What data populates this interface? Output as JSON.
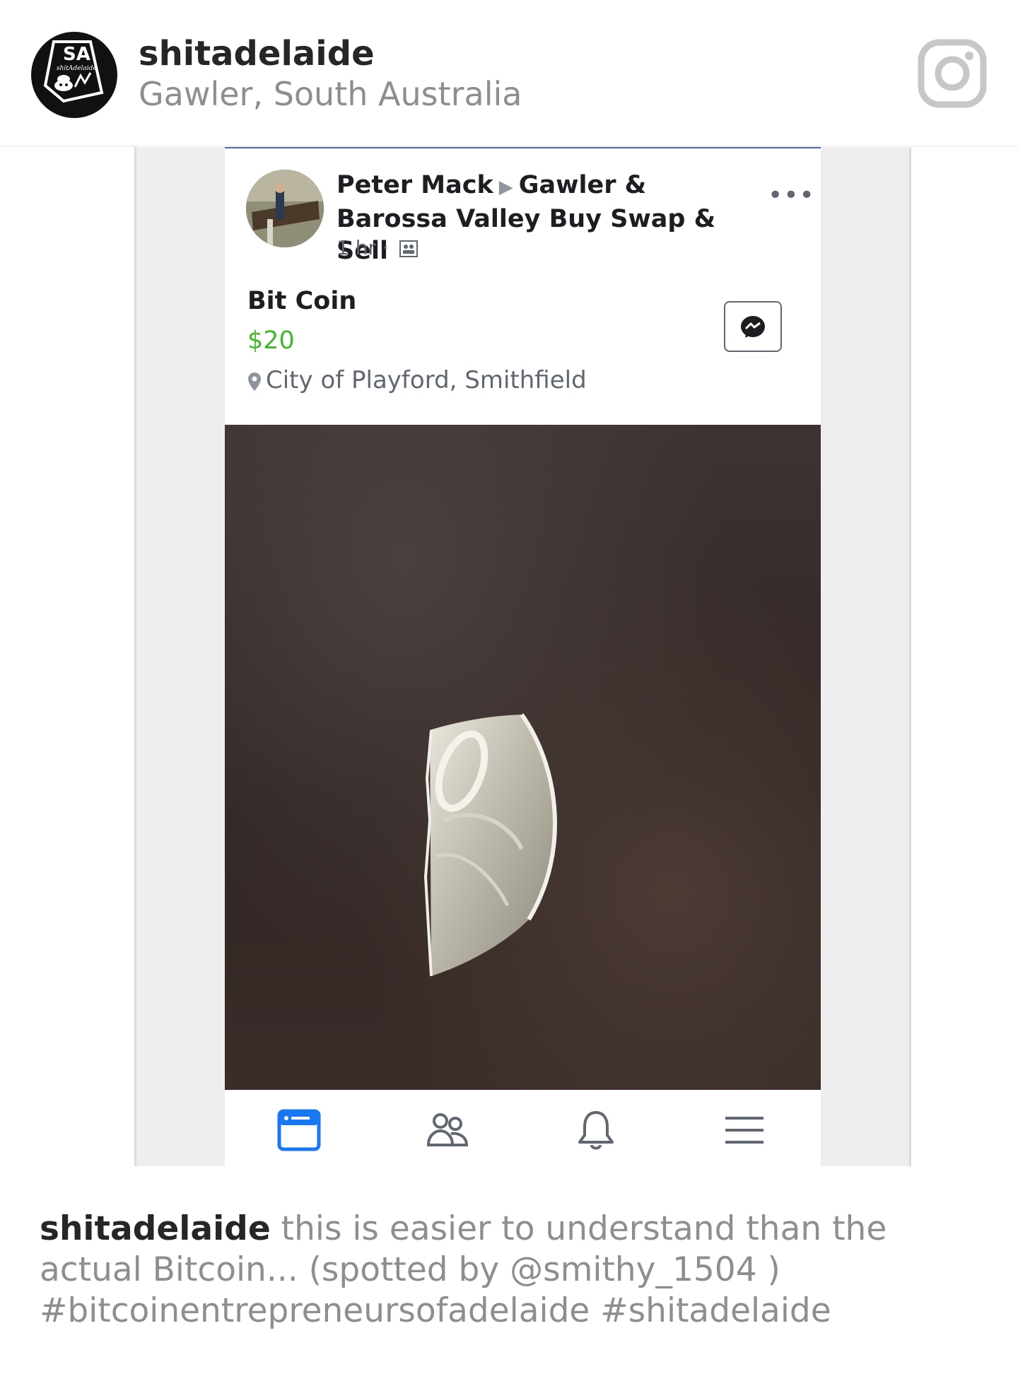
{
  "instagram": {
    "username": "shitadelaide",
    "location": "Gawler, South Australia",
    "caption": {
      "username": "shitadelaide",
      "text": "this is easier to understand than the actual Bitcoin... (spotted by @smithy_1504 ) #bitcoinentrepreneursofadelaide #shitadelaide"
    },
    "avatar_logo": {
      "text": "SA",
      "script": "shitAdelaide"
    }
  },
  "facebook_post": {
    "author": "Peter Mack",
    "group": "Gawler & Barossa Valley Buy Swap & Sell",
    "time": "1 hr",
    "meta_separator": "·",
    "item_title": "Bit Coin",
    "price": "$20",
    "location": "City of Playford, Smithfield",
    "more_label": "•••"
  },
  "colors": {
    "price_green": "#42b72a",
    "fb_active_tab": "#1877f2",
    "ig_gray": "#8e8e8e"
  },
  "icons": {
    "instagram": "instagram-logo-icon",
    "messenger": "messenger-icon",
    "tabs": [
      "news-feed-icon",
      "friends-icon",
      "notifications-bell-icon",
      "menu-icon"
    ]
  }
}
